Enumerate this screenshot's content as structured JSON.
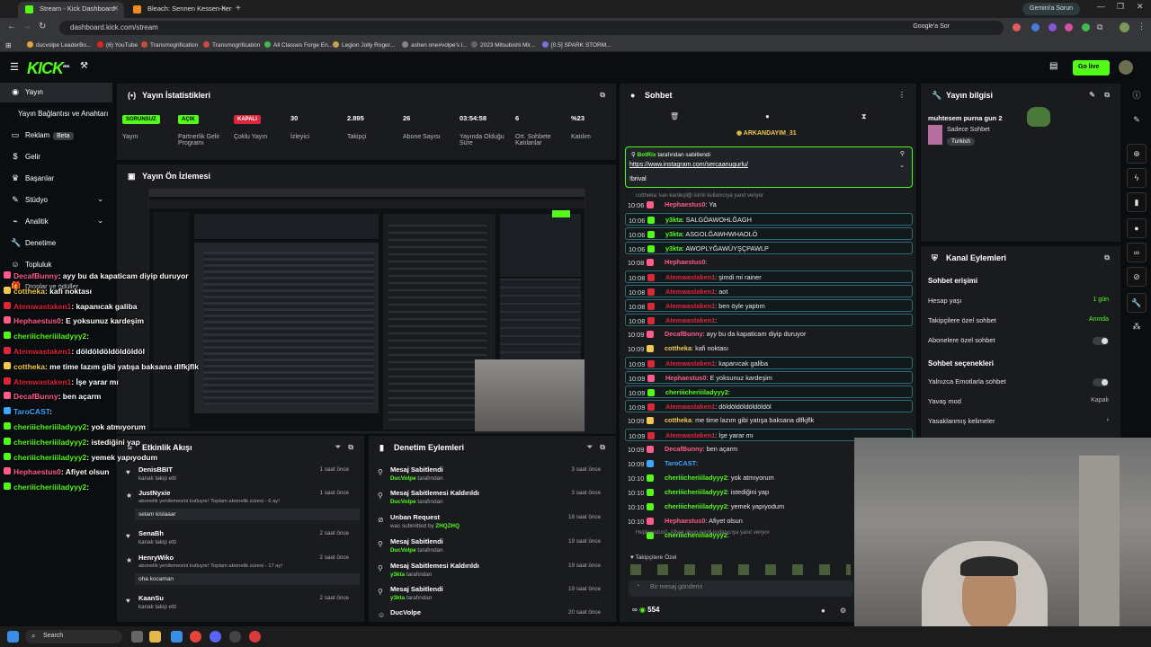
{
  "browser": {
    "tabs": [
      {
        "label": "Stream - Kick Dashboard",
        "active": true,
        "color": "#53fc18"
      },
      {
        "label": "Bleach: Sennen Kessen-hen - K",
        "active": false,
        "color": "#f28b22"
      }
    ],
    "gemini_label": "Gemini'a Sorun",
    "url": "dashboard.kick.com/stream",
    "google_ask": "Google'a Sor",
    "bookmarks": [
      "ducvolpe LeaderBo...",
      "(6) YouTube",
      "Transmogrification",
      "Transmogrification",
      "All Classes Forge En...",
      "Legion Jolly Roger...",
      "ashen one#volpe's l...",
      "2023 Mitsubishi Mir...",
      "[0.5] SPARK STORM..."
    ]
  },
  "kick": {
    "logo": "KICK",
    "logo_sup": "BETA",
    "go_live": "Go live"
  },
  "sidebar": {
    "items": [
      {
        "label": "Yayın",
        "icon": "broadcast-icon",
        "selected": true
      },
      {
        "label": "Yayın Bağlantısı ve Anahtarı",
        "icon": "",
        "selected": false
      },
      {
        "label": "Reklam",
        "icon": "tv-icon",
        "badge": "Beta"
      },
      {
        "label": "Gelir",
        "icon": "money-icon"
      },
      {
        "label": "Başarılar",
        "icon": "trophy-icon"
      },
      {
        "label": "Stüdyo",
        "icon": "palette-icon",
        "chevron": true
      },
      {
        "label": "Analitik",
        "icon": "analytics-icon",
        "chevron": true
      },
      {
        "label": "Denetime",
        "icon": "wrench-icon"
      },
      {
        "label": "Topluluk",
        "icon": "community-icon"
      },
      {
        "label": "Droplar ve ödüller",
        "icon": "gift-icon"
      }
    ]
  },
  "stats_panel": {
    "title": "Yayın İstatistikleri",
    "items": [
      {
        "value": "SORUNSUZ",
        "label": "Yayın",
        "pill_color": "#53fc18"
      },
      {
        "value": "AÇIK",
        "label": "Partnerlik Gelir Programı",
        "pill_color": "#53fc18"
      },
      {
        "value": "KAPALI",
        "label": "Çoklu Yayın",
        "pill_color": "#e0243a"
      },
      {
        "value": "30",
        "label": "İzleyici"
      },
      {
        "value": "2.895",
        "label": "Takipçi"
      },
      {
        "value": "26",
        "label": "Abone Sayısı"
      },
      {
        "value": "03:54:58",
        "label": "Yayında Olduğu Süre"
      },
      {
        "value": "6",
        "label": "Ort. Sohbete Katılanlar"
      },
      {
        "value": "%23",
        "label": "Katılım"
      }
    ]
  },
  "preview_panel": {
    "title": "Yayın Ön İzlemesi"
  },
  "activity_panel": {
    "title": "Etkinlik Akışı",
    "events": [
      {
        "name": "DenisBBIT",
        "sub": "kanalı takip etti",
        "time": "1 saat önce",
        "icon": "heart-icon"
      },
      {
        "name": "JustNyxie",
        "sub": "abonelik yenilemesini kutluyor! Toplam abonelik süresi - 6 ay!",
        "time": "1 saat önce",
        "icon": "star-icon",
        "msg": "selam kislaaar"
      },
      {
        "name": "SenaBh",
        "sub": "kanalı takip etti",
        "time": "2 saat önce",
        "icon": "heart-icon"
      },
      {
        "name": "HenryWiko",
        "sub": "abonelik yenilemesini kutluyor! Toplam abonelik süresi - 17 ay!",
        "time": "2 saat önce",
        "icon": "star-icon",
        "msg": "oha kocaman"
      },
      {
        "name": "KaanSu",
        "sub": "kanalı takip etti",
        "time": "2 saat önce",
        "icon": "heart-icon"
      }
    ]
  },
  "moderation_panel": {
    "title": "Denetim Eylemleri",
    "events": [
      {
        "name": "Mesaj Sabitlendi",
        "by": "DucVolpe",
        "suffix": "tarafından",
        "time": "3 saat önce",
        "icon": "pin-icon"
      },
      {
        "name": "Mesaj Sabitlemesi Kaldırıldı",
        "by": "DucVolpe",
        "suffix": "tarafından",
        "time": "3 saat önce",
        "icon": "pin-icon"
      },
      {
        "name": "Unban Request",
        "by": "ZHQZHQ",
        "prefix": "was submitted by",
        "time": "18 saat önce",
        "icon": "unban-icon"
      },
      {
        "name": "Mesaj Sabitlendi",
        "by": "DucVolpe",
        "suffix": "tarafından",
        "time": "19 saat önce",
        "icon": "pin-icon"
      },
      {
        "name": "Mesaj Sabitlemesi Kaldırıldı",
        "by": "y3kta",
        "suffix": "tarafından",
        "time": "19 saat önce",
        "icon": "pin-icon"
      },
      {
        "name": "Mesaj Sabitlendi",
        "by": "y3kta",
        "suffix": "tarafından",
        "time": "19 saat önce",
        "icon": "pin-icon"
      },
      {
        "name": "DucVolpe",
        "by": "",
        "suffix": "",
        "time": "20 saat önce",
        "icon": "user-icon"
      }
    ]
  },
  "chat_panel": {
    "title": "Sohbet",
    "gifter": "ARKANDAYIM_31",
    "pinned_by": "BotRix",
    "pinned_suffix": "tarafından sabitlendi",
    "pinned_link": "https://www.instagram.com/sercaanugurlu/",
    "pinned_cmd": "!brival",
    "reply_note": "cottheka: kan kardeşliği isimli kullanıcıya yanıt veriyor",
    "reply_note2": "Hephaestus0: Afiyet olsun isimli kullanıcıya yanıt veriyor",
    "messages": [
      {
        "time": "10:06",
        "user": "Hephaestus0",
        "color": "#ff5c8a",
        "text": "Ya",
        "hl": false
      },
      {
        "time": "10:06",
        "user": "y3kta",
        "color": "#53fc18",
        "text": "SALGÖAWOHLĞAGH",
        "hl": true
      },
      {
        "time": "10:06",
        "user": "y3kta",
        "color": "#53fc18",
        "text": "ASGOLĞAWHWHAOLÖ",
        "hl": true
      },
      {
        "time": "10:06",
        "user": "y3kta",
        "color": "#53fc18",
        "text": "AWOPLYĞAWÜYŞÇPAWLP",
        "hl": true
      },
      {
        "time": "10:08",
        "user": "Hephaestus0",
        "color": "#ff5c8a",
        "text": "",
        "hl": false
      },
      {
        "time": "10:08",
        "user": "Atemwastaken1",
        "color": "#e0243a",
        "text": "şimdi mi rainer",
        "hl": true
      },
      {
        "time": "10:08",
        "user": "Atemwastaken1",
        "color": "#e0243a",
        "text": "aot",
        "hl": true
      },
      {
        "time": "10:08",
        "user": "Atemwastaken1",
        "color": "#e0243a",
        "text": "ben öyle yaptım",
        "hl": true
      },
      {
        "time": "10:08",
        "user": "Atemwastaken1",
        "color": "#e0243a",
        "text": "",
        "hl": true
      },
      {
        "time": "10:09",
        "user": "DecafBunny",
        "color": "#ff5c8a",
        "text": "ayy bu da kapaticam diyip duruyor",
        "hl": false
      },
      {
        "time": "10:09",
        "user": "cottheka",
        "color": "#f2c94c",
        "text": "kafi noktası",
        "hl": false
      },
      {
        "time": "10:09",
        "user": "Atemwastaken1",
        "color": "#e0243a",
        "text": "kapanıcak galiba",
        "hl": true
      },
      {
        "time": "10:09",
        "user": "Hephaestus0",
        "color": "#ff5c8a",
        "text": "E yoksunuz kardeşim",
        "hl": true
      },
      {
        "time": "10:09",
        "user": "cheriiicheriiiladyyy2",
        "color": "#53fc18",
        "text": "",
        "hl": true
      },
      {
        "time": "10:09",
        "user": "Atemwastaken1",
        "color": "#e0243a",
        "text": "döldöldöldöldöldöl",
        "hl": true
      },
      {
        "time": "10:09",
        "user": "cottheka",
        "color": "#f2c94c",
        "text": "me time lazım gibi yatışa baksana dlfkjflk",
        "hl": false
      },
      {
        "time": "10:09",
        "user": "Atemwastaken1",
        "color": "#e0243a",
        "text": "İşe yarar mı",
        "hl": true
      },
      {
        "time": "10:09",
        "user": "DecafBunny",
        "color": "#ff5c8a",
        "text": "ben açarm",
        "hl": false
      },
      {
        "time": "10:09",
        "user": "TaroCAST",
        "color": "#3ba7ff",
        "text": "",
        "hl": false
      },
      {
        "time": "10:10",
        "user": "cheriiicheriiiladyyy2",
        "color": "#53fc18",
        "text": "yok atmıyorum",
        "hl": false
      },
      {
        "time": "10:10",
        "user": "cheriiicheriiiladyyy2",
        "color": "#53fc18",
        "text": "istediğini yap",
        "hl": false
      },
      {
        "time": "10:10",
        "user": "cheriiicheriiiladyyy2",
        "color": "#53fc18",
        "text": "yemek yapıyodum",
        "hl": false
      },
      {
        "time": "10:10",
        "user": "Hephaestus0",
        "color": "#ff5c8a",
        "text": "Afiyet olsun",
        "hl": false
      },
      {
        "time": "",
        "user": "cheriiicheriiiladyyy2",
        "color": "#53fc18",
        "text": "",
        "hl": false
      }
    ],
    "emote_label": "Takipçilere Özel",
    "input_placeholder": "Bir mesaj gönderin",
    "points": "554"
  },
  "info_panel": {
    "title": "Yayın bilgisi",
    "stream_title": "muhtesem purna gun 2",
    "category": "Sadece Sohbet",
    "tag": "Turkish"
  },
  "channel_actions": {
    "title": "Kanal Eylemleri",
    "section1": "Sohbet erişimi",
    "rows1": [
      {
        "label": "Hesap yaşı",
        "value": "1 gün",
        "value_color": "#53fc18"
      },
      {
        "label": "Takipçilere özel sohbet",
        "value": "Anında",
        "value_color": "#53fc18"
      },
      {
        "label": "Abonelere özel sohbet",
        "toggle": true
      }
    ],
    "section2": "Sohbet seçenekleri",
    "rows2": [
      {
        "label": "Yalnızca Emotlarla sohbet",
        "toggle": true
      },
      {
        "label": "Yavaş mod",
        "value": "Kapalı",
        "value_color": "#bbbbbb"
      },
      {
        "label": "Yasaklanmış kelimeler",
        "value": ""
      }
    ]
  },
  "overlay_chat": [
    {
      "user": "DecafBunny",
      "color": "#ff5c8a",
      "text": ": ayy bu da kapaticam diyip duruyor"
    },
    {
      "user": "cottheka",
      "color": "#f2c94c",
      "text": ": kafi noktası"
    },
    {
      "user": "Atemwastaken1",
      "color": "#e0243a",
      "text": ": kapanıcak galiba"
    },
    {
      "user": "Hephaestus0",
      "color": "#ff5c8a",
      "text": ": E yoksunuz kardeşim"
    },
    {
      "user": "cheriiicheriiiladyyy2",
      "color": "#53fc18",
      "text": ":"
    },
    {
      "user": "Atemwastaken1",
      "color": "#e0243a",
      "text": ": döldöldöldöldöldöl"
    },
    {
      "user": "cottheka",
      "color": "#f2c94c",
      "text": ": me time lazım gibi yatışa baksana dlfkjflk"
    },
    {
      "user": "Atemwastaken1",
      "color": "#e0243a",
      "text": ": İşe yarar mı"
    },
    {
      "user": "DecafBunny",
      "color": "#ff5c8a",
      "text": ": ben açarm"
    },
    {
      "user": "TaroCAST",
      "color": "#3ba7ff",
      "text": ":"
    },
    {
      "user": "cheriiicheriiiladyyy2",
      "color": "#53fc18",
      "text": ": yok atmıyorum"
    },
    {
      "user": "cheriiicheriiiladyyy2",
      "color": "#53fc18",
      "text": ": istediğini yap"
    },
    {
      "user": "cheriiicheriiiladyyy2",
      "color": "#53fc18",
      "text": ": yemek yapıyodum"
    },
    {
      "user": "Hephaestus0",
      "color": "#ff5c8a",
      "text": ": Afiyet olsun"
    },
    {
      "user": "cheriiicheriiiladyyy2",
      "color": "#53fc18",
      "text": ":"
    }
  ],
  "taskbar": {
    "search_placeholder": "Search"
  }
}
